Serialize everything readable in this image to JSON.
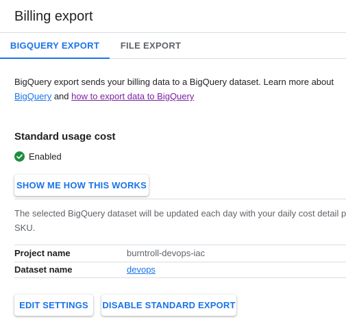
{
  "header": {
    "title": "Billing export"
  },
  "tabs": [
    {
      "label": "BIGQUERY EXPORT",
      "active": true
    },
    {
      "label": "FILE EXPORT",
      "active": false
    }
  ],
  "intro": {
    "text": "BigQuery export sends your billing data to a BigQuery dataset. Learn more about",
    "link1": "BigQuery",
    "and": " and ",
    "link2": "how to export data to BigQuery"
  },
  "standard_usage": {
    "title": "Standard usage cost",
    "status": "Enabled",
    "status_icon": "check-circle-icon",
    "show_how_label": "SHOW ME HOW THIS WORKS",
    "description_line1": "The selected BigQuery dataset will be updated each day with your daily cost detail pe",
    "description_line2": "SKU."
  },
  "details": [
    {
      "label": "Project name",
      "value": "burntroll-devops-iac"
    },
    {
      "label": "Dataset name",
      "value": "devops"
    }
  ],
  "actions": {
    "edit_label": "EDIT SETTINGS",
    "disable_label": "DISABLE STANDARD EXPORT"
  },
  "colors": {
    "accent": "#1a73e8",
    "visited_link": "#7b1fa2",
    "success": "#1e8e3e"
  }
}
